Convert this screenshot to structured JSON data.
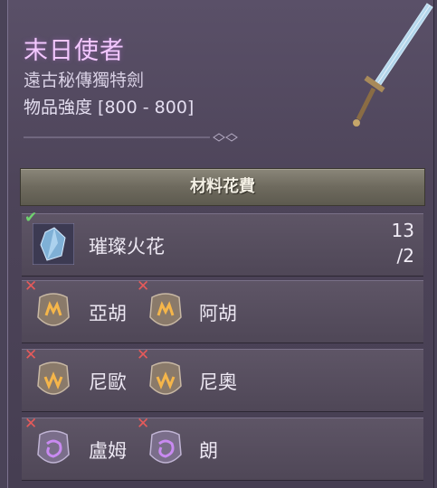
{
  "item": {
    "name": "末日使者",
    "subtitle": "遠古秘傳獨特劍",
    "strength": "物品強度 [800 - 800]"
  },
  "cost": {
    "header": "材料花費",
    "main_material": {
      "name": "璀璨火花",
      "have": "13",
      "need": "/2",
      "icon": "crystal-icon",
      "status": "satisfied"
    },
    "runes_left": [
      {
        "name": "亞胡",
        "icon": "rune-icon",
        "status": "missing"
      },
      {
        "name": "尼歐",
        "icon": "rune-icon",
        "status": "missing"
      },
      {
        "name": "盧姆",
        "icon": "rune-icon",
        "status": "missing"
      }
    ],
    "runes_right": [
      {
        "name": "阿胡",
        "icon": "rune-icon",
        "status": "missing"
      },
      {
        "name": "尼奧",
        "icon": "rune-icon",
        "status": "missing"
      },
      {
        "name": "朗",
        "icon": "rune-icon",
        "status": "missing"
      }
    ]
  },
  "colors": {
    "title": "#f3c7ff",
    "check": "#6fd26f",
    "cross": "#e65a5a"
  }
}
